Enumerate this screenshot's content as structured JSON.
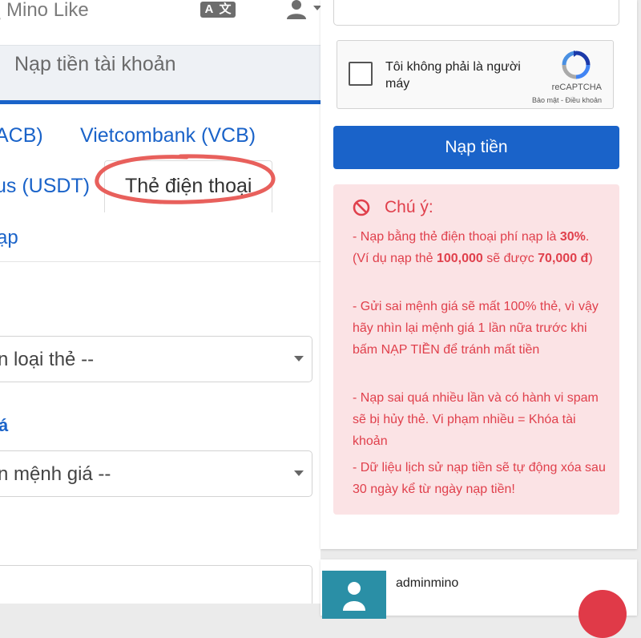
{
  "header": {
    "brand": "Mino Like",
    "translate_icon": "translate-icon",
    "user_icon": "user-icon",
    "page_title": "Nạp tiền tài khoản"
  },
  "tabs": {
    "acb": "ACB)",
    "vcb": "Vietcombank (VCB)",
    "usdt": "us (USDT)",
    "phone": "Thẻ điện thoại",
    "other": "ạp"
  },
  "form": {
    "card_type_select": "n loại thẻ --",
    "value_label_fragment": "á",
    "card_value_select": "n mệnh giá --"
  },
  "recaptcha": {
    "label": "Tôi không phải là người máy",
    "brand": "reCAPTCHA",
    "terms": "Bảo mật - Điều khoản"
  },
  "submit_label": "Nạp tiền",
  "notice": {
    "title": "Chú ý:",
    "p1_a": "- Nạp bằng thẻ điện thoại phí nạp là ",
    "p1_b": "30%",
    "p1_c": ". (Ví dụ nạp thẻ ",
    "p1_d": "100,000",
    "p1_e": " sẽ được ",
    "p1_f": "70,000 đ",
    "p1_g": ")",
    "p2": "- Gửi sai mệnh giá sẽ mất 100% thẻ, vì vậy hãy nhìn lại mệnh giá 1 lần nữa trước khi bấm NẠP TIỀN để tránh mất tiền",
    "p3": "- Nạp sai quá nhiều lần và có hành vi spam sẽ bị hủy thẻ. Vi phạm nhiều = Khóa tài khoản",
    "p4": "- Dữ liệu lịch sử nạp tiền sẽ tự động xóa sau 30 ngày kể từ ngày nạp tiền!"
  },
  "chat": {
    "username": "adminmino"
  },
  "colors": {
    "primary": "#1a63c9",
    "danger_text": "#e0404c",
    "danger_bg": "#fbe3e5",
    "highlight": "#e8605c"
  }
}
